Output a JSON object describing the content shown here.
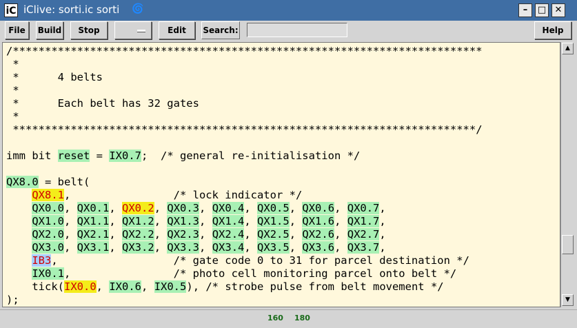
{
  "window": {
    "app_icon": "iC",
    "title": "iClive: sorti.ic sorti",
    "title_glyph": "spiral-icon",
    "controls": [
      "minimize-icon",
      "maximize-icon",
      "close-icon"
    ]
  },
  "toolbar": {
    "file": "File",
    "build": "Build",
    "stop": "Stop",
    "combo_value": "",
    "edit": "Edit",
    "search_label": "Search:",
    "search_value": "",
    "help": "Help"
  },
  "colors": {
    "immediate_highlight": "#a8f0b4",
    "active_highlight": "#f4ec1a",
    "input_highlight": "#a8cfff",
    "editor_background": "#fff8dc",
    "titlebar": "#3f6ea4"
  },
  "code_lines": [
    "/*************************************************************************",
    " *",
    " *      4 belts",
    " *",
    " *      Each belt has 32 gates",
    " *",
    " ************************************************************************/",
    "",
    "imm bit reset = IX0.7;  /* general re-initialisation */",
    "",
    "QX8.0 = belt(",
    "    QX8.1,                /* lock indicator */",
    "    QX0.0, QX0.1, QX0.2, QX0.3, QX0.4, QX0.5, QX0.6, QX0.7,",
    "    QX1.0, QX1.1, QX1.2, QX1.3, QX1.4, QX1.5, QX1.6, QX1.7,",
    "    QX2.0, QX2.1, QX2.2, QX2.3, QX2.4, QX2.5, QX2.6, QX2.7,",
    "    QX3.0, QX3.1, QX3.2, QX3.3, QX3.4, QX3.5, QX3.6, QX3.7,",
    "    IB3,                  /* gate code 0 to 31 for parcel destination */",
    "    IX0.1,                /* photo cell monitoring parcel onto belt */",
    "    tick(IX0.0, IX0.6, IX0.5), /* strobe pulse from belt movement */",
    ");"
  ],
  "status": {
    "value_a": "160",
    "value_b": "180"
  }
}
